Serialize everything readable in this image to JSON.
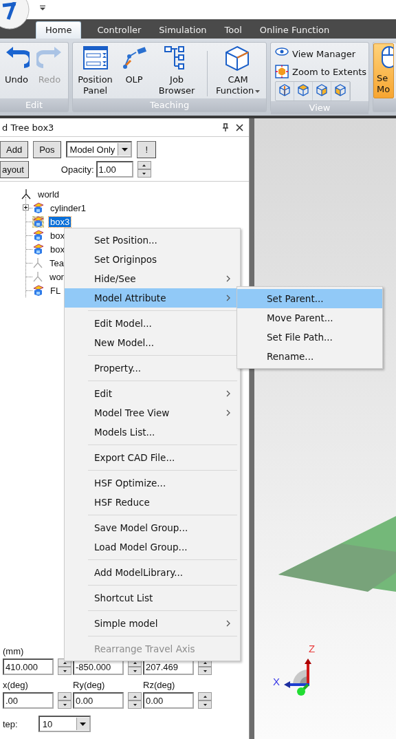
{
  "tabs": [
    {
      "label": "Home",
      "selected": true
    },
    {
      "label": "Controller",
      "selected": false
    },
    {
      "label": "Simulation",
      "selected": false
    },
    {
      "label": "Tool",
      "selected": false
    },
    {
      "label": "Online Function",
      "selected": false
    }
  ],
  "ribbon": {
    "groups": [
      {
        "label": "Edit",
        "kind": "large",
        "buttons": [
          {
            "kind": "undo",
            "label": "Undo",
            "disabled": false,
            "dropdown": false,
            "highlighted": false
          },
          {
            "kind": "redo",
            "label": "Redo",
            "disabled": true,
            "dropdown": false,
            "highlighted": false
          }
        ]
      },
      {
        "label": "Teaching",
        "kind": "large",
        "buttons": [
          {
            "kind": "panel",
            "label": "Position Panel",
            "disabled": false,
            "dropdown": false,
            "highlighted": false
          },
          {
            "kind": "olp",
            "label": "OLP",
            "disabled": false,
            "dropdown": false,
            "highlighted": false
          },
          {
            "kind": "tree",
            "label": "Job Browser",
            "disabled": false,
            "dropdown": false,
            "highlighted": false
          },
          {
            "kind": "separator"
          },
          {
            "kind": "cube",
            "label": "CAM Function",
            "disabled": false,
            "dropdown": true,
            "highlighted": false
          }
        ]
      },
      {
        "label": "View",
        "kind": "view",
        "buttons": [
          {
            "kind": "eye",
            "label": "View Manager"
          },
          {
            "kind": "zoom",
            "label": "Zoom to Extents"
          }
        ],
        "icon_buttons": [
          {
            "kind": "axis"
          },
          {
            "kind": "top"
          },
          {
            "kind": "side"
          },
          {
            "kind": "front"
          }
        ]
      },
      {
        "kind": "large",
        "buttons": [
          {
            "kind": "mouse",
            "label": "Se Mo",
            "disabled": false,
            "dropdown": false,
            "highlighted": true
          }
        ]
      }
    ]
  },
  "panel": {
    "title": "d Tree box3",
    "toolbar": {
      "buttons": [
        "Add",
        "Pos"
      ],
      "filter": "Model Only",
      "alert_button": "!",
      "layout_button": "ayout",
      "opacity_label": "Opacity:",
      "opacity_value": "1.00"
    },
    "tree": [
      {
        "label": "world",
        "kind": "frame",
        "selected": false,
        "children": [
          {
            "label": "cylinder1",
            "kind": "model",
            "selected": false,
            "expanded": false
          },
          {
            "label": "box3",
            "kind": "model",
            "selected": true
          },
          {
            "label": "box",
            "kind": "model",
            "selected": false
          },
          {
            "label": "box",
            "kind": "model",
            "selected": false
          },
          {
            "label": "Tea",
            "kind": "frame",
            "selected": false
          },
          {
            "label": "wor",
            "kind": "frame",
            "selected": false
          },
          {
            "label": "FL",
            "kind": "model",
            "selected": false
          }
        ]
      }
    ],
    "position": {
      "rows": [
        {
          "labels": [
            "(mm)"
          ],
          "fields": [
            "410.000",
            "-850.000",
            "207.469"
          ]
        },
        {
          "labels": [
            "x(deg)",
            "Ry(deg)",
            "Rz(deg)"
          ],
          "fields": [
            ".00",
            "0.00",
            "0.00"
          ]
        }
      ],
      "step_label": "tep:",
      "step_value": "10"
    }
  },
  "context_menu": {
    "items": [
      {
        "kind": "item",
        "label": "Set Position...",
        "has_submenu": false,
        "selected": false,
        "disabled": false
      },
      {
        "kind": "item",
        "label": "Set Originpos",
        "has_submenu": false,
        "selected": false,
        "disabled": false
      },
      {
        "kind": "item",
        "label": "Hide/See",
        "has_submenu": true,
        "selected": false,
        "disabled": false
      },
      {
        "kind": "item",
        "label": "Model Attribute",
        "has_submenu": true,
        "selected": true,
        "disabled": false
      },
      {
        "kind": "separator"
      },
      {
        "kind": "item",
        "label": "Edit Model...",
        "has_submenu": false,
        "selected": false,
        "disabled": false
      },
      {
        "kind": "item",
        "label": "New Model...",
        "has_submenu": false,
        "selected": false,
        "disabled": false
      },
      {
        "kind": "separator"
      },
      {
        "kind": "item",
        "label": "Property...",
        "has_submenu": false,
        "selected": false,
        "disabled": false
      },
      {
        "kind": "separator"
      },
      {
        "kind": "item",
        "label": "Edit",
        "has_submenu": true,
        "selected": false,
        "disabled": false
      },
      {
        "kind": "item",
        "label": "Model Tree View",
        "has_submenu": true,
        "selected": false,
        "disabled": false
      },
      {
        "kind": "item",
        "label": "Models List...",
        "has_submenu": false,
        "selected": false,
        "disabled": false
      },
      {
        "kind": "separator"
      },
      {
        "kind": "item",
        "label": "Export CAD File...",
        "has_submenu": false,
        "selected": false,
        "disabled": false
      },
      {
        "kind": "separator"
      },
      {
        "kind": "item",
        "label": "HSF Optimize...",
        "has_submenu": false,
        "selected": false,
        "disabled": false
      },
      {
        "kind": "item",
        "label": "HSF Reduce",
        "has_submenu": false,
        "selected": false,
        "disabled": false
      },
      {
        "kind": "separator"
      },
      {
        "kind": "item",
        "label": "Save Model Group...",
        "has_submenu": false,
        "selected": false,
        "disabled": false
      },
      {
        "kind": "item",
        "label": "Load Model Group...",
        "has_submenu": false,
        "selected": false,
        "disabled": false
      },
      {
        "kind": "separator"
      },
      {
        "kind": "item",
        "label": "Add ModelLibrary...",
        "has_submenu": false,
        "selected": false,
        "disabled": false
      },
      {
        "kind": "separator"
      },
      {
        "kind": "item",
        "label": "Shortcut List",
        "has_submenu": false,
        "selected": false,
        "disabled": false
      },
      {
        "kind": "separator"
      },
      {
        "kind": "item",
        "label": "Simple model",
        "has_submenu": true,
        "selected": false,
        "disabled": false
      },
      {
        "kind": "separator"
      },
      {
        "kind": "item",
        "label": "Rearrange Travel Axis",
        "has_submenu": false,
        "selected": false,
        "disabled": true
      }
    ],
    "submenu": [
      {
        "label": "Set Parent...",
        "selected": true
      },
      {
        "label": "Move Parent...",
        "selected": false
      },
      {
        "label": "Set File Path...",
        "selected": false
      },
      {
        "label": "Rename...",
        "selected": false
      }
    ]
  },
  "viewport": {
    "x_axis_label": "X",
    "z_axis_label": "Z"
  }
}
